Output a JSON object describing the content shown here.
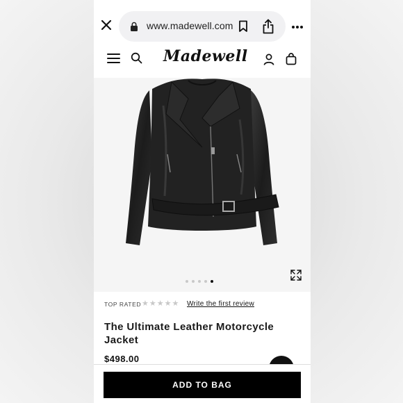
{
  "browser": {
    "url": "www.madewell.com"
  },
  "header": {
    "logo_text": "Madewell"
  },
  "gallery": {
    "image_count": 5,
    "active_index": 4
  },
  "product": {
    "top_rated_label": "TOP RATED",
    "star_rating": 0,
    "star_count": 5,
    "review_link": "Write the first review",
    "title": "The Ultimate Leather Motorcycle Jacket",
    "price": "$498.00"
  },
  "actions": {
    "add_to_bag_label": "ADD TO BAG"
  },
  "colors": {
    "brand_black": "#000000",
    "star_empty": "#c8c8c8",
    "url_bar_bg": "#f1f1f3"
  }
}
